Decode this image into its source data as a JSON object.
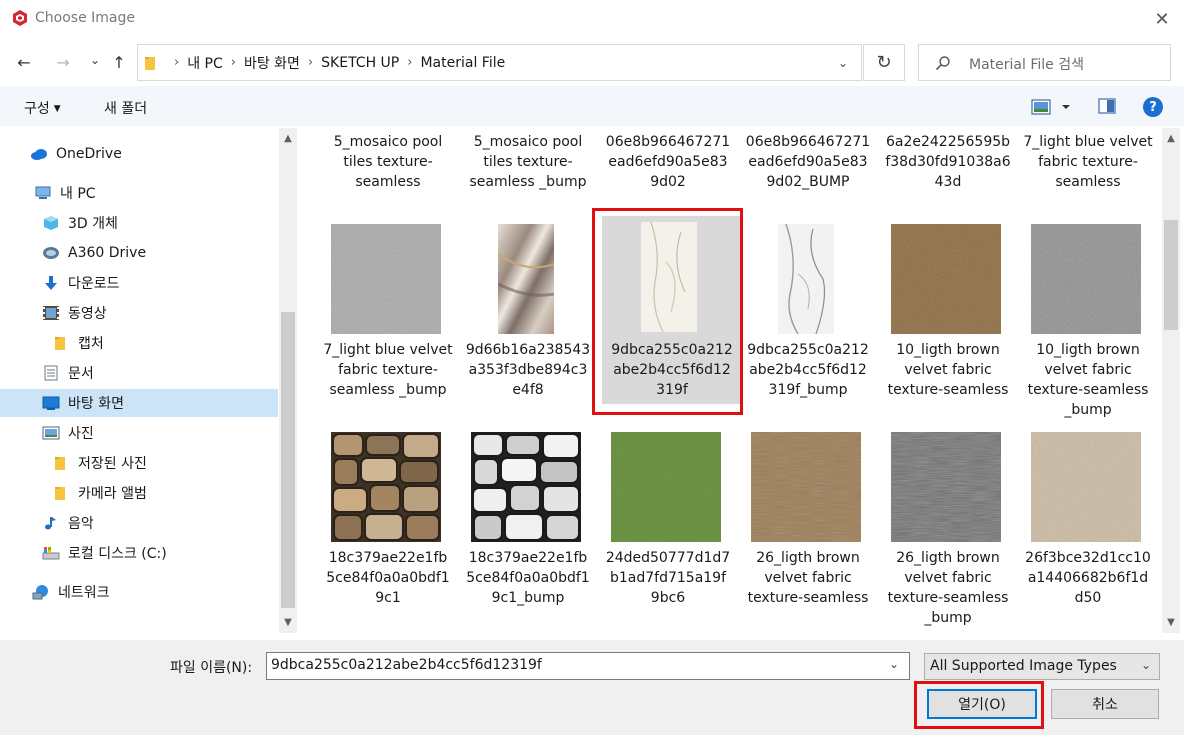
{
  "window": {
    "title": "Choose Image",
    "close_glyph": "✕"
  },
  "nav": {
    "back_glyph": "←",
    "forward_glyph": "→",
    "recent_glyph": "⌄",
    "up_glyph": "↑",
    "breadcrumbs": [
      "내 PC",
      "바탕 화면",
      "SKETCH UP",
      "Material File"
    ],
    "breadcrumb_separator": "›",
    "refresh_glyph": "↻",
    "search_placeholder": "Material File 검색"
  },
  "toolbar": {
    "organize_label": "구성",
    "new_folder_label": "새 폴더",
    "help_label": "?"
  },
  "sidebar": {
    "items": [
      {
        "label": "OneDrive",
        "icon": "onedrive-icon"
      },
      {
        "label": "내 PC",
        "icon": "pc-icon"
      },
      {
        "label": "3D 개체",
        "icon": "3d-objects-icon"
      },
      {
        "label": "A360 Drive",
        "icon": "a360-drive-icon"
      },
      {
        "label": "다운로드",
        "icon": "download-icon"
      },
      {
        "label": "동영상",
        "icon": "video-icon"
      },
      {
        "label": "캡처",
        "icon": "folder-icon"
      },
      {
        "label": "문서",
        "icon": "document-icon"
      },
      {
        "label": "바탕 화면",
        "icon": "desktop-icon",
        "selected": true
      },
      {
        "label": "사진",
        "icon": "pictures-icon"
      },
      {
        "label": "저장된 사진",
        "icon": "folder-icon"
      },
      {
        "label": "카메라 앨범",
        "icon": "folder-icon"
      },
      {
        "label": "음악",
        "icon": "music-icon"
      },
      {
        "label": "로컬 디스크 (C:)",
        "icon": "disk-icon"
      },
      {
        "label": "네트워크",
        "icon": "network-icon"
      }
    ]
  },
  "files": {
    "row1": [
      {
        "label": "5_mosaico pool tiles texture-seamless"
      },
      {
        "label": "5_mosaico pool tiles texture-seamless _bump"
      },
      {
        "label": "06e8b966467271 ead6efd90a5e83 9d02"
      },
      {
        "label": "06e8b966467271 ead6efd90a5e83 9d02_BUMP"
      },
      {
        "label": "6a2e242256595b f38d30fd91038a6 43d"
      },
      {
        "label": "7_light blue velvet fabric texture-seamless"
      }
    ],
    "row2": [
      {
        "label": "7_light blue velvet fabric texture-seamless _bump"
      },
      {
        "label": "9d66b16a238543 a353f3dbe894c3 e4f8"
      },
      {
        "label": "9dbca255c0a212 abe2b4cc5f6d12 319f",
        "selected": true
      },
      {
        "label": "9dbca255c0a212 abe2b4cc5f6d12 319f_bump"
      },
      {
        "label": "10_ligth brown velvet fabric texture-seamless"
      },
      {
        "label": "10_ligth brown velvet fabric texture-seamless _bump"
      }
    ],
    "row3": [
      {
        "label": "18c379ae22e1fb 5ce84f0a0a0bdf1 9c1"
      },
      {
        "label": "18c379ae22e1fb 5ce84f0a0a0bdf1 9c1_bump"
      },
      {
        "label": "24ded50777d1d7 b1ad7fd715a19f 9bc6"
      },
      {
        "label": "26_ligth brown velvet fabric texture-seamless"
      },
      {
        "label": "26_ligth brown velvet fabric texture-seamless _bump"
      },
      {
        "label": "26f3bce32d1cc10 a14406682b6f1d d50"
      }
    ]
  },
  "footer": {
    "filename_label": "파일 이름(N):",
    "filename_value": "9dbca255c0a212abe2b4cc5f6d12319f",
    "filetype_value": "All Supported Image Types",
    "open_label": "열기(O)",
    "cancel_label": "취소"
  },
  "colors": {
    "highlight": "#e01010",
    "selection": "#cce4f7",
    "accent": "#0078d7"
  }
}
